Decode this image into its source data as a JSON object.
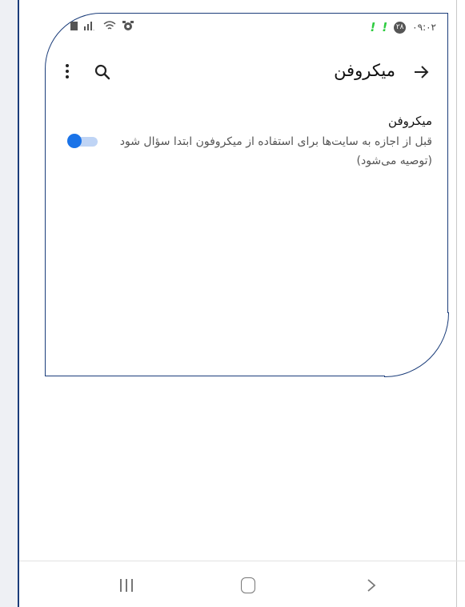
{
  "status_bar": {
    "left_icons": [
      "square-icon",
      "signal-icon",
      "wifi-icon",
      "alarm-icon"
    ],
    "right_badge": "۲۸",
    "time": "۰۹:۰۲",
    "notification_color": "#2ecc40"
  },
  "app_bar": {
    "title": "میکروفن",
    "icons": [
      "back-arrow-icon",
      "search-icon",
      "more-vert-icon"
    ]
  },
  "setting": {
    "title": "میکروفن",
    "description": "قبل از اجازه به سایت‌ها برای استفاده از میکروفون ابتدا سؤال شود (توصیه می‌شود)",
    "toggle_on": true,
    "accent_color": "#1a73e8"
  },
  "nav_bar": {
    "icons": [
      "recent-apps-icon",
      "home-icon",
      "back-icon"
    ]
  },
  "highlight_color": "#1b3d7a"
}
